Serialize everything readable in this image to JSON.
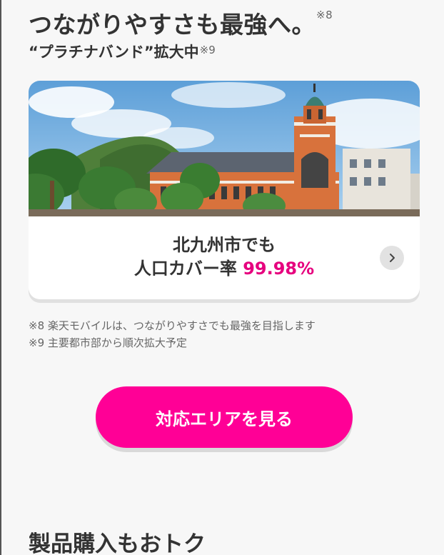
{
  "headline": {
    "text": "つながりやすさも最強へ。",
    "note_ref": "※8"
  },
  "subhead": {
    "text": "“プラチナバンド”拡大中",
    "note_ref": "※9"
  },
  "coverage_card": {
    "line1": "北九州市でも",
    "line2_prefix": "人口カバー率 ",
    "coverage_rate": "99.98%",
    "arrow_icon": "chevron-right-icon",
    "accent_color": "#e6007e"
  },
  "notes": [
    "※8 楽天モバイルは、つながりやすさでも最強を目指します",
    "※9 主要都市部から順次拡大予定"
  ],
  "cta": {
    "label": "対応エリアを見る",
    "color": "#ff0096"
  },
  "next_section": {
    "title": "製品購入もおトク"
  }
}
